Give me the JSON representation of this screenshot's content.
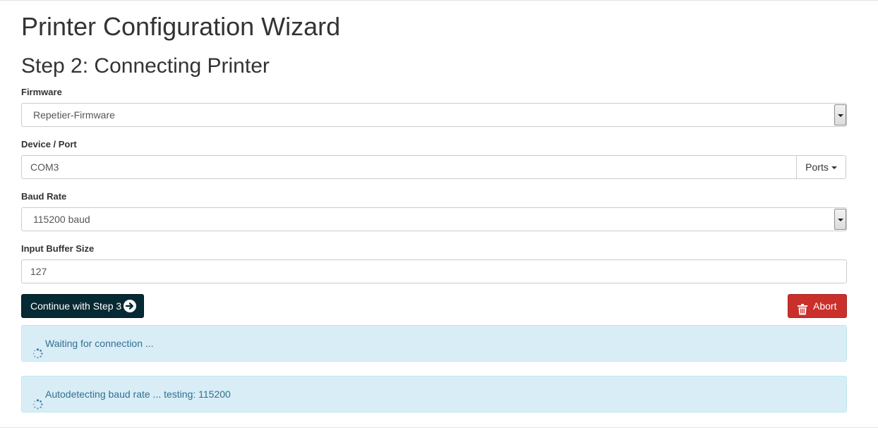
{
  "page": {
    "title": "Printer Configuration Wizard",
    "step_title": "Step 2: Connecting Printer"
  },
  "form": {
    "firmware": {
      "label": "Firmware",
      "value": "Repetier-Firmware"
    },
    "device_port": {
      "label": "Device / Port",
      "value": "COM3",
      "ports_button": "Ports"
    },
    "baud_rate": {
      "label": "Baud Rate",
      "value": "115200 baud"
    },
    "input_buffer": {
      "label": "Input Buffer Size",
      "value": "127"
    }
  },
  "actions": {
    "continue_label": "Continue with Step 3",
    "abort_label": "Abort"
  },
  "alerts": [
    {
      "text": "Waiting for connection ..."
    },
    {
      "text": "Autodetecting baud rate ... testing: 115200"
    }
  ],
  "colors": {
    "primary": "#062a33",
    "danger": "#c9302c",
    "info_bg": "#d9edf7",
    "info_text": "#31708f"
  },
  "icons": {
    "continue": "circle-arrow-right-icon",
    "abort": "trash-icon",
    "alerts": "spinner-icon",
    "select": "chevron-down-icon",
    "ports": "caret-down-icon"
  }
}
